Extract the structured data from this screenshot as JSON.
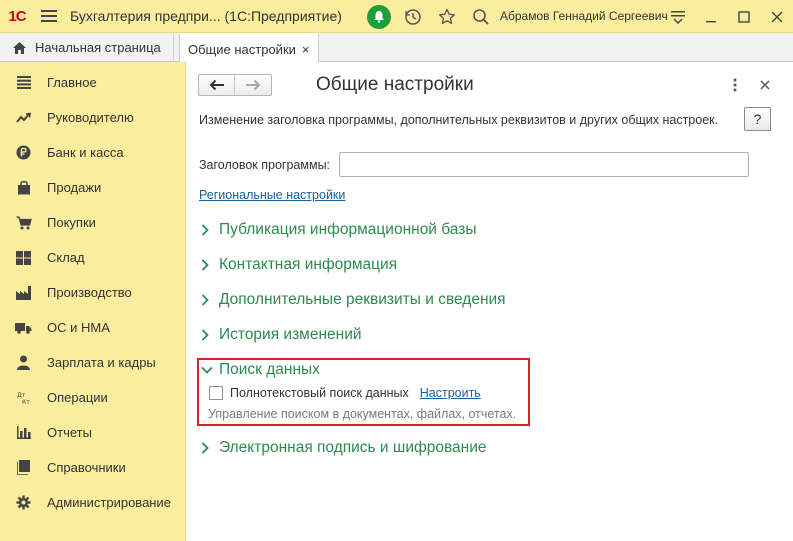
{
  "app": {
    "logo_text": "1С",
    "title": "Бухгалтерия предпри... (1С:Предприятие)",
    "user": "Абрамов Геннадий Сергеевич"
  },
  "tabs": [
    {
      "label": "Начальная страница",
      "icon": "home-icon"
    },
    {
      "label": "Общие настройки",
      "active": true
    }
  ],
  "tab_close": "×",
  "sidebar": {
    "items": [
      {
        "label": "Главное",
        "icon": "menu-list-icon"
      },
      {
        "label": "Руководителю",
        "icon": "trend-icon"
      },
      {
        "label": "Банк и касса",
        "icon": "ruble-coin-icon"
      },
      {
        "label": "Продажи",
        "icon": "shopping-bag-icon"
      },
      {
        "label": "Покупки",
        "icon": "cart-icon"
      },
      {
        "label": "Склад",
        "icon": "warehouse-grid-icon"
      },
      {
        "label": "Производство",
        "icon": "factory-icon"
      },
      {
        "label": "ОС и НМА",
        "icon": "truck-icon"
      },
      {
        "label": "Зарплата и кадры",
        "icon": "person-icon"
      },
      {
        "label": "Операции",
        "icon": "debit-credit-icon"
      },
      {
        "label": "Отчеты",
        "icon": "bar-chart-icon"
      },
      {
        "label": "Справочники",
        "icon": "book-icon"
      },
      {
        "label": "Администрирование",
        "icon": "gear-icon"
      }
    ]
  },
  "main": {
    "title": "Общие настройки",
    "help_label": "?",
    "description": "Изменение заголовка программы, дополнительных реквизитов и других общих настроек.",
    "program_title_label": "Заголовок программы:",
    "program_title_value": "",
    "regional_link": "Региональные настройки",
    "sections": [
      {
        "label": "Публикация информационной базы",
        "expanded": false
      },
      {
        "label": "Контактная информация",
        "expanded": false
      },
      {
        "label": "Дополнительные реквизиты и сведения",
        "expanded": false
      },
      {
        "label": "История изменений",
        "expanded": false
      },
      {
        "label": "Поиск данных",
        "expanded": true
      },
      {
        "label": "Электронная подпись и шифрование",
        "expanded": false
      }
    ],
    "search": {
      "checkbox_label": "Полнотекстовый поиск данных",
      "checked": false,
      "config_link": "Настроить",
      "hint": "Управление поиском в документах, файлах, отчетах."
    }
  },
  "colors": {
    "accent_yellow": "#fbed9e",
    "section_green": "#2d8a4e",
    "link_blue": "#1a5fa0",
    "highlight_red": "#d8232a",
    "bell_green": "#1f9e3b"
  }
}
